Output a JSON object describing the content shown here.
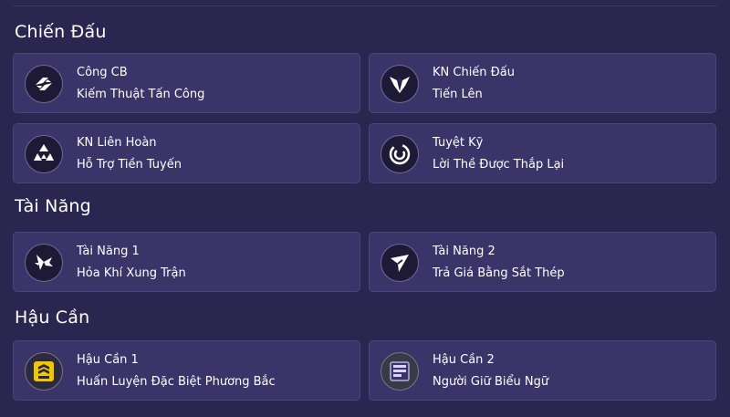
{
  "sections": [
    {
      "title": "Chiến Đấu",
      "cards": [
        {
          "line1": "Công CB",
          "line2": "Kiếm Thuật Tấn Công",
          "icon": "basic-attack-icon"
        },
        {
          "line1": "KN Chiến Đấu",
          "line2": "Tiến Lên",
          "icon": "combat-skill-icon"
        },
        {
          "line1": "KN Liên Hoàn",
          "line2": "Hỗ Trợ Tiền Tuyến",
          "icon": "combo-skill-icon"
        },
        {
          "line1": "Tuyệt Kỹ",
          "line2": "Lời Thề Được Thắp Lại",
          "icon": "ultimate-icon"
        }
      ]
    },
    {
      "title": "Tài Năng",
      "cards": [
        {
          "line1": "Tài Năng 1",
          "line2": "Hỏa Khí Xung Trận",
          "icon": "talent-1-icon"
        },
        {
          "line1": "Tài Năng 2",
          "line2": "Trả Giá Bằng Sắt Thép",
          "icon": "talent-2-icon"
        }
      ]
    },
    {
      "title": "Hậu Cần",
      "cards": [
        {
          "line1": "Hậu Cần 1",
          "line2": "Huấn Luyện Đặc Biệt Phương Bắc",
          "icon": "logistics-1-icon"
        },
        {
          "line1": "Hậu Cần 2",
          "line2": "Người Giữ Biểu Ngữ",
          "icon": "logistics-2-icon"
        }
      ]
    }
  ],
  "colors": {
    "background": "#2b2650",
    "card": "#3a3468",
    "card_border": "#4a4480",
    "icon_bg": "#1e1a36",
    "logistics_yellow": "#f0c800"
  }
}
